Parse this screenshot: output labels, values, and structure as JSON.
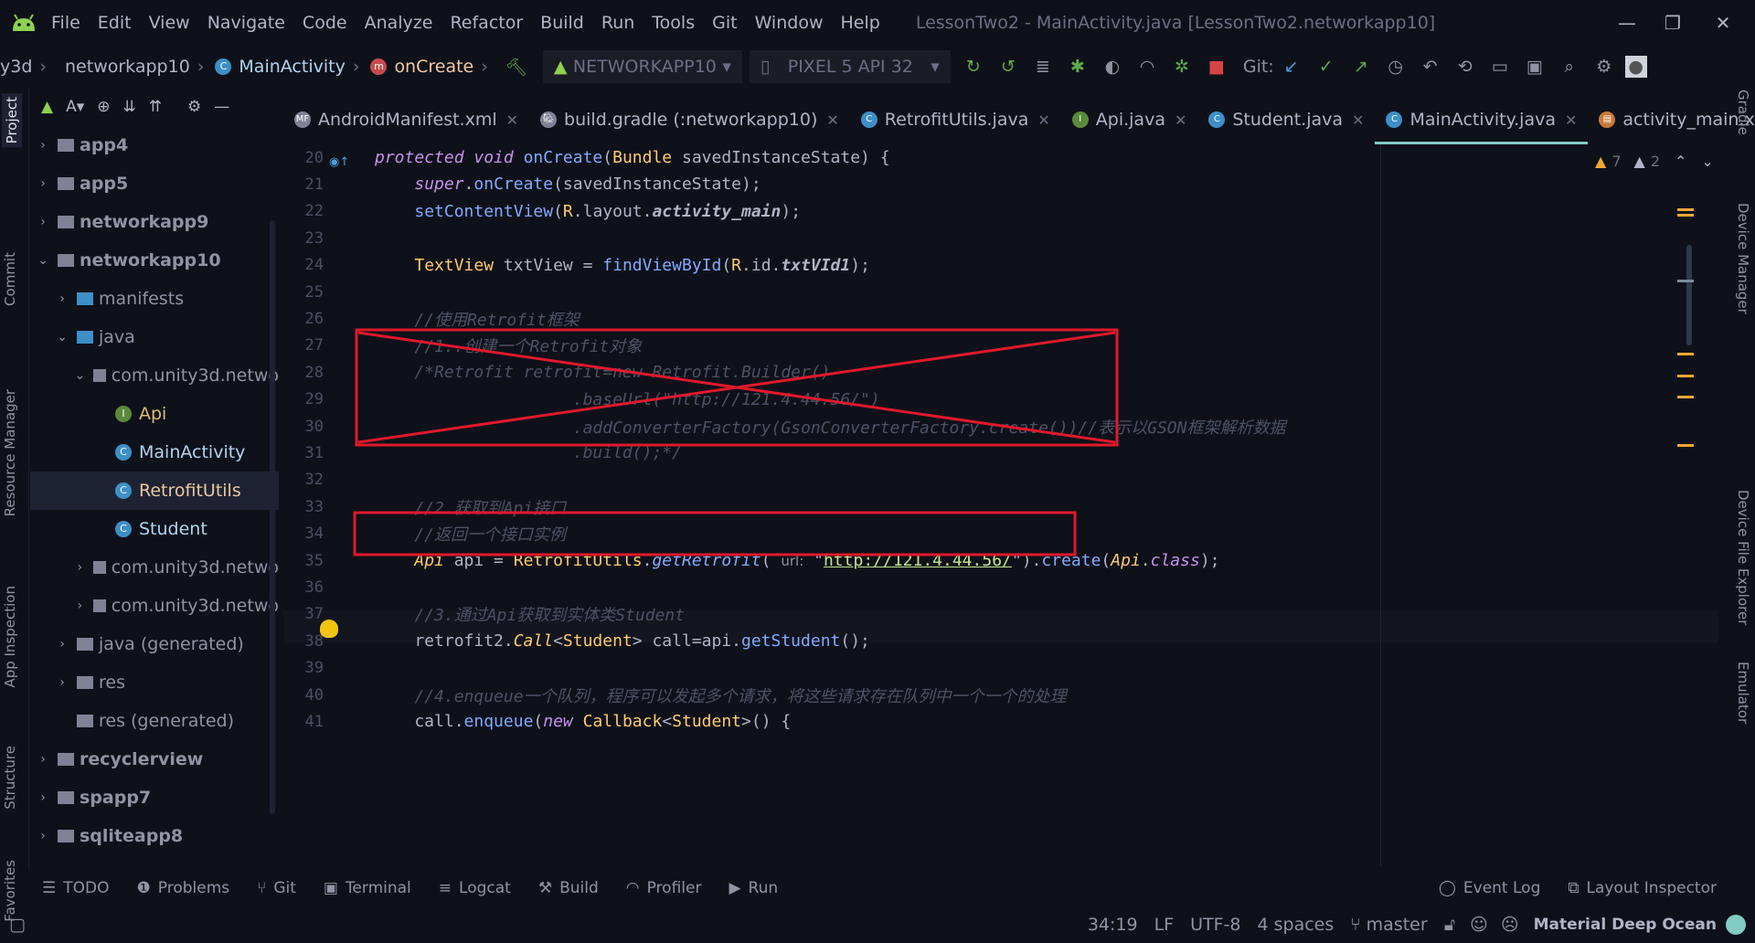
{
  "window": {
    "menu": [
      "File",
      "Edit",
      "View",
      "Navigate",
      "Code",
      "Analyze",
      "Refactor",
      "Build",
      "Run",
      "Tools",
      "Git",
      "Window",
      "Help"
    ],
    "title": "LessonTwo2 - MainActivity.java [LessonTwo2.networkapp10]"
  },
  "toolbar": {
    "breadcrumbs": [
      "y3d",
      "networkapp10",
      "MainActivity",
      "onCreate"
    ],
    "run_config": "NETWORKAPP10",
    "device": "PIXEL 5 API 32",
    "git_label": "Git:"
  },
  "left_strip": [
    "Project",
    "Commit",
    "Resource Manager",
    "App Inspection",
    "Structure",
    "Favorites"
  ],
  "right_strip": [
    "Gradle",
    "Device Manager",
    "Device File Explorer",
    "Emulator"
  ],
  "project_tree": [
    {
      "label": "app4",
      "depth": 0,
      "arrow": "›",
      "icon": "folder-gray",
      "bold": true
    },
    {
      "label": "app5",
      "depth": 0,
      "arrow": "›",
      "icon": "folder-gray",
      "bold": true
    },
    {
      "label": "networkapp9",
      "depth": 0,
      "arrow": "›",
      "icon": "folder-gray",
      "bold": true
    },
    {
      "label": "networkapp10",
      "depth": 0,
      "arrow": "⌄",
      "icon": "folder-gray",
      "bold": true
    },
    {
      "label": "manifests",
      "depth": 1,
      "arrow": "›",
      "icon": "folder-blue"
    },
    {
      "label": "java",
      "depth": 1,
      "arrow": "⌄",
      "icon": "folder-blue"
    },
    {
      "label": "com.unity3d.netwo",
      "depth": 2,
      "arrow": "⌄",
      "icon": "folder-gray"
    },
    {
      "label": "Api",
      "depth": 3,
      "arrow": "",
      "icon": "interface"
    },
    {
      "label": "MainActivity",
      "depth": 3,
      "arrow": "",
      "icon": "class"
    },
    {
      "label": "RetrofitUtils",
      "depth": 3,
      "arrow": "",
      "icon": "class",
      "selected": true
    },
    {
      "label": "Student",
      "depth": 3,
      "arrow": "",
      "icon": "class"
    },
    {
      "label": "com.unity3d.netwo",
      "depth": 2,
      "arrow": "›",
      "icon": "folder-gray"
    },
    {
      "label": "com.unity3d.netwo",
      "depth": 2,
      "arrow": "›",
      "icon": "folder-gray"
    },
    {
      "label": "java (generated)",
      "depth": 1,
      "arrow": "›",
      "icon": "folder-gray"
    },
    {
      "label": "res",
      "depth": 1,
      "arrow": "›",
      "icon": "folder-gray"
    },
    {
      "label": "res (generated)",
      "depth": 1,
      "arrow": "",
      "icon": "folder-gray"
    },
    {
      "label": "recyclerview",
      "depth": 0,
      "arrow": "›",
      "icon": "folder-gray",
      "bold": true
    },
    {
      "label": "spapp7",
      "depth": 0,
      "arrow": "›",
      "icon": "folder-gray",
      "bold": true
    },
    {
      "label": "sqliteapp8",
      "depth": 0,
      "arrow": "›",
      "icon": "folder-gray",
      "bold": true
    }
  ],
  "tabs": [
    {
      "label": "AndroidManifest.xml",
      "icon": "manifest"
    },
    {
      "label": "build.gradle (:networkapp10)",
      "icon": "gradle"
    },
    {
      "label": "RetrofitUtils.java",
      "icon": "class"
    },
    {
      "label": "Api.java",
      "icon": "interface"
    },
    {
      "label": "Student.java",
      "icon": "class"
    },
    {
      "label": "MainActivity.java",
      "icon": "class",
      "active": true
    },
    {
      "label": "activity_main.xml",
      "icon": "layout"
    }
  ],
  "inspections": {
    "warnings": "7",
    "weak_warnings": "2"
  },
  "code_lines": [
    {
      "n": "20",
      "html": "<span class='kw'>protected void</span> <span class='fn'>onCreate</span>(<span class='cls'>Bundle</span> savedInstanceState) {"
    },
    {
      "n": "21",
      "html": "    <span class='kw'>super</span>.<span class='fn'>onCreate</span>(savedInstanceState);"
    },
    {
      "n": "22",
      "html": "    <span class='fn'>setContentView</span>(<span class='cls'>R</span>.layout.<b class='it'>activity_main</b>);"
    },
    {
      "n": "23",
      "html": ""
    },
    {
      "n": "24",
      "html": "    <span class='cls'>TextView</span> txtView = <span class='fn'>findViewById</span>(<span class='cls'>R</span>.id.<b class='it'>txtVId1</b>);"
    },
    {
      "n": "25",
      "html": ""
    },
    {
      "n": "26",
      "html": "    <span class='cmt'>//使用Retrofit框架</span>"
    },
    {
      "n": "27",
      "html": "    <span class='cmt'>//1..创建一个Retrofit对象</span>"
    },
    {
      "n": "28",
      "html": "    <span class='cmt'>/*Retrofit retrofit=new Retrofit.Builder()</span>"
    },
    {
      "n": "29",
      "html": "                    <span class='cmt'>.baseUrl(\"http://121.4.44.56/\")</span>"
    },
    {
      "n": "30",
      "html": "                    <span class='cmt'>.addConverterFactory(GsonConverterFactory.create())//表示以GSON框架解析数据</span>"
    },
    {
      "n": "31",
      "html": "                    <span class='cmt'>.build();*/</span>"
    },
    {
      "n": "32",
      "html": ""
    },
    {
      "n": "33",
      "html": "    <span class='cmt'>//2.获取到Api接口</span>"
    },
    {
      "n": "34",
      "html": "    <span class='cmt'>//返回一个接口实例</span>"
    },
    {
      "n": "35",
      "html": "    <span class='cls it'>Api</span> api = <span class='cls'>RetrofitUtils</span>.<span class='fn it'>getRetrofit</span>( <span style='color:#8f93a2;font-family:\"DejaVu Sans\",sans-serif;font-size:15px'>url:</span> \"<span class='str' style='text-decoration:underline'>http://121.4.44.56/</span>\").<span class='fn'>create</span>(<span class='cls it'>Api</span>.<span class='kw'>class</span>);"
    },
    {
      "n": "36",
      "html": ""
    },
    {
      "n": "37",
      "html": "    <span class='cmt'>//3.通过Api获取到实体类Student</span>"
    },
    {
      "n": "38",
      "html": "    retrofit2.<span class='cls it'>Call</span>&lt;<span class='cls'>Student</span>&gt; call=api.<span class='fn'>getStudent</span>();"
    },
    {
      "n": "39",
      "html": ""
    },
    {
      "n": "40",
      "html": "    <span class='cmt'>//4.enqueue一个队列，程序可以发起多个请求，将这些请求存在队列中一个一个的处理</span>"
    },
    {
      "n": "41",
      "html": "    call.<span class='fn'>enqueue</span>(<span class='kw'>new</span> <span class='cls'>Callback</span>&lt;<span class='cls'>Student</span>&gt;() {"
    }
  ],
  "toolwindows_left": [
    "TODO",
    "Problems",
    "Git",
    "Terminal",
    "Logcat",
    "Build",
    "Profiler",
    "Run"
  ],
  "toolwindows_right": [
    "Event Log",
    "Layout Inspector"
  ],
  "status": {
    "position": "34:19",
    "line_sep": "LF",
    "encoding": "UTF-8",
    "indent": "4 spaces",
    "branch": "master",
    "theme": "Material Deep Ocean"
  },
  "colors": {
    "accent": "#80cbc4",
    "annotation_red": "#e0192b",
    "bg": "#0f111a"
  }
}
